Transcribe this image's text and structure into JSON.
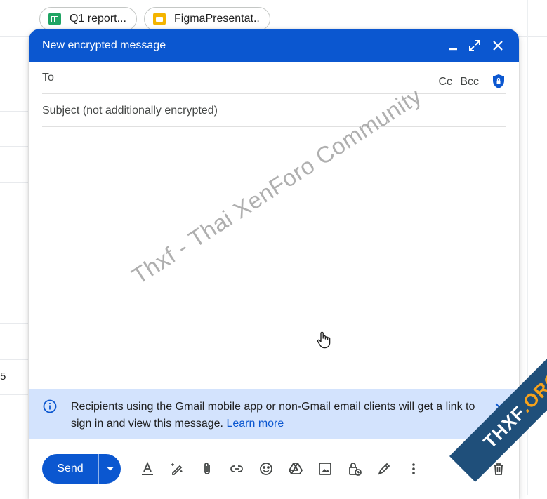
{
  "background": {
    "chips": [
      {
        "label": "Q1 report...",
        "icon": "sheets-icon"
      },
      {
        "label": "FigmaPresentat..",
        "icon": "slides-icon"
      }
    ],
    "side_number": "5"
  },
  "compose": {
    "title": "New encrypted message",
    "header_colors": {
      "bar": "#0b57d0",
      "text": "#ffffff"
    },
    "to_label": "To",
    "cc_label": "Cc",
    "bcc_label": "Bcc",
    "subject_placeholder": "Subject (not additionally encrypted)",
    "body_watermark": "Thxf - Thai XenForo Community",
    "info_banner": {
      "text": "Recipients using the Gmail mobile app or non-Gmail email clients will get a link to sign in and view this message.",
      "link": "Learn more",
      "color": "#d3e3fd"
    },
    "send_label": "Send",
    "toolbar_icons": [
      "format-text-icon",
      "magic-pen-icon",
      "attach-icon",
      "link-icon",
      "emoji-icon",
      "drive-icon",
      "image-icon",
      "confidential-lock-icon",
      "signature-icon",
      "more-options-icon",
      "trash-icon"
    ]
  },
  "watermark_ribbon": {
    "text_left": "THXF",
    "text_right": ".ORG"
  }
}
